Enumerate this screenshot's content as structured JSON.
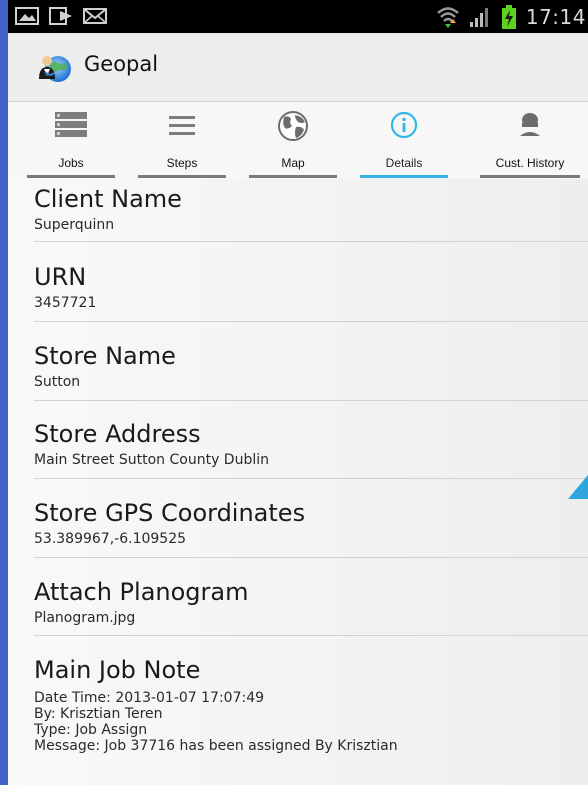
{
  "status_bar": {
    "time": "17:14",
    "left_icons": [
      "image-notification-icon",
      "forward-notification-icon",
      "mail-notification-icon"
    ],
    "right_icons": [
      "wifi-icon",
      "signal-icon",
      "battery-charging-icon"
    ]
  },
  "action_bar": {
    "app_title": "Geopal",
    "logo_icon": "geopal-globe-user-icon"
  },
  "tabs": [
    {
      "label": "Jobs",
      "icon": "jobs-list-icon"
    },
    {
      "label": "Steps",
      "icon": "steps-menu-icon"
    },
    {
      "label": "Map",
      "icon": "globe-map-icon"
    },
    {
      "label": "Details",
      "icon": "info-icon",
      "selected": true
    },
    {
      "label": "Cust. History",
      "icon": "customer-icon"
    }
  ],
  "details": {
    "client_name": {
      "label": "Client Name",
      "value": "Superquinn"
    },
    "urn": {
      "label": "URN",
      "value": "3457721"
    },
    "store_name": {
      "label": "Store Name",
      "value": "Sutton"
    },
    "store_address": {
      "label": "Store Address",
      "value": "Main Street Sutton County Dublin"
    },
    "store_gps": {
      "label": "Store GPS Coordinates",
      "value": "53.389967,-6.109525"
    },
    "attach_planogram": {
      "label": "Attach Planogram",
      "value": "Planogram.jpg"
    },
    "main_job_note": {
      "label": "Main Job Note",
      "lines": [
        "Date Time: 2013-01-07 17:07:49",
        "By: Krisztian Teren",
        "Type: Job Assign",
        "Message: Job 37716 has been assigned By Krisztian"
      ]
    }
  },
  "colors": {
    "frame_blue": "#3f63c6",
    "accent_holo_blue": "#33b5e5",
    "status_bar": "#000000"
  }
}
